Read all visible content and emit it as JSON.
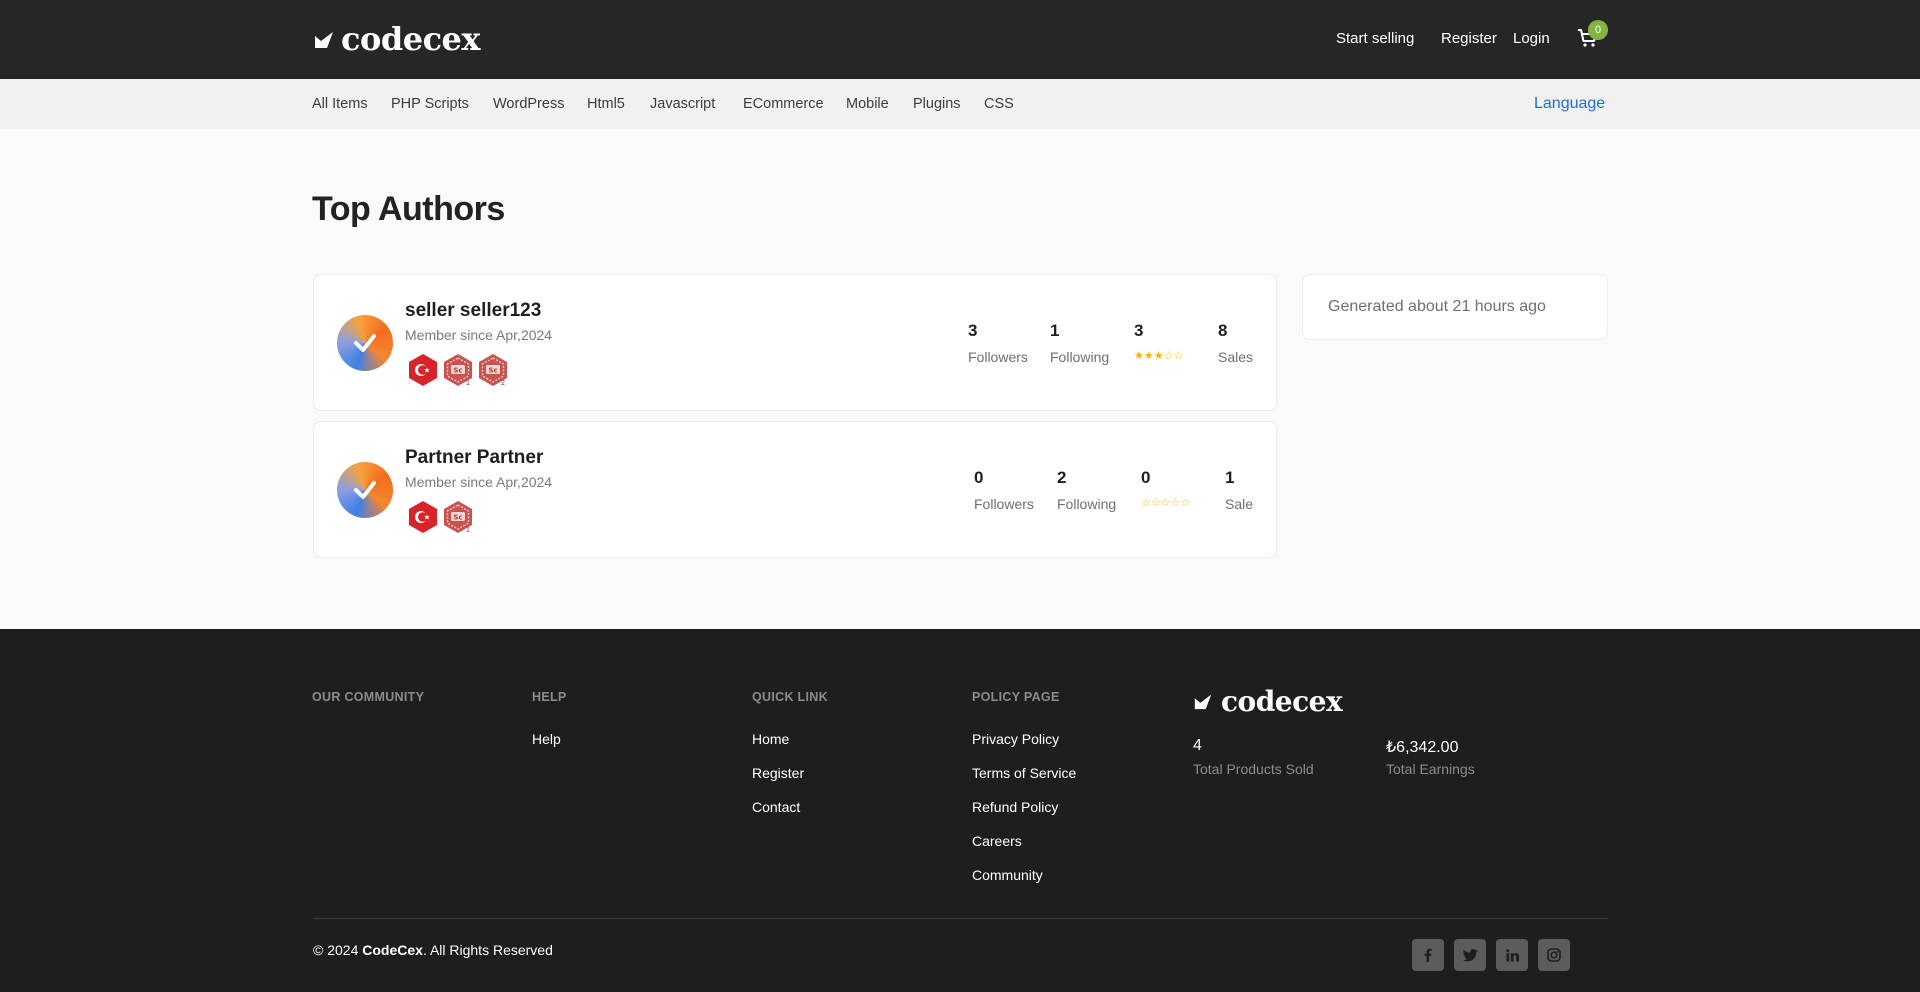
{
  "header": {
    "brand": "codecex",
    "start_selling": "Start selling",
    "register": "Register",
    "login": "Login",
    "cart_count": "0"
  },
  "categories": [
    "All Items",
    "PHP Scripts",
    "WordPress",
    "Html5",
    "Javascript",
    "ECommerce",
    "Mobile",
    "Plugins",
    "CSS"
  ],
  "language": "Language",
  "page_title": "Top Authors",
  "authors": [
    {
      "name": "seller seller123",
      "member_since": "Member since Apr,2024",
      "followers": "3",
      "followers_label": "Followers",
      "following": "1",
      "following_label": "Following",
      "rating": "3",
      "rating_stars": "★★★☆☆",
      "sales": "8",
      "sales_label": "Sales"
    },
    {
      "name": "Partner Partner",
      "member_since": "Member since Apr,2024",
      "followers": "0",
      "followers_label": "Followers",
      "following": "2",
      "following_label": "Following",
      "rating": "0",
      "rating_stars": "☆☆☆☆☆",
      "sales": "1",
      "sales_label": "Sale"
    }
  ],
  "generated": "Generated about 21 hours ago",
  "footer": {
    "col_community": "OUR COMMUNITY",
    "col_help": "HELP",
    "col_quick": "QUICK LINK",
    "col_policy": "POLICY PAGE",
    "help_links": [
      "Help"
    ],
    "quick_links": [
      "Home",
      "Register",
      "Contact"
    ],
    "policy_links": [
      "Privacy Policy",
      "Terms of Service",
      "Refund Policy",
      "Careers",
      "Community"
    ],
    "brand": "codecex",
    "products_sold": "4",
    "products_sold_label": "Total Products Sold",
    "earnings": "₺6,342.00",
    "earnings_label": "Total Earnings",
    "copyright_prefix": "© 2024 ",
    "copyright_brand": "CodeCex",
    "copyright_suffix": ". All Rights Reserved",
    "social_icons": [
      "facebook-icon",
      "twitter-icon",
      "linkedin-icon",
      "instagram-icon"
    ]
  },
  "colors": {
    "header_bg": "#262626",
    "footer_bg": "#1e1e1e",
    "accent_link": "#1e6fd9",
    "cart_badge": "#82b440",
    "star": "#f5b301",
    "badge_red": "#d8232a"
  }
}
